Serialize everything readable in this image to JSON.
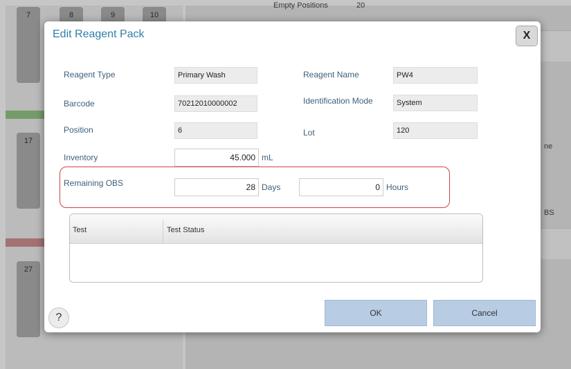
{
  "background": {
    "slot_numbers_top": [
      "7",
      "8",
      "9",
      "10"
    ],
    "slot_numbers_mid": [
      "17"
    ],
    "slot_numbers_bottom": [
      "27"
    ],
    "empty_positions_label": "Empty Positions",
    "empty_positions_value": "20",
    "side_text_1": "ne",
    "side_text_2": "BS"
  },
  "dialog": {
    "title": "Edit Reagent Pack",
    "close_label": "X",
    "fields": {
      "reagent_type_label": "Reagent Type",
      "reagent_type_value": "Primary Wash",
      "reagent_name_label": "Reagent Name",
      "reagent_name_value": "PW4",
      "barcode_label": "Barcode",
      "barcode_value": "70212010000002",
      "identification_mode_label": "Identification Mode",
      "identification_mode_value": "System",
      "position_label": "Position",
      "position_value": "6",
      "lot_label": "Lot",
      "lot_value": "120",
      "inventory_label": "Inventory",
      "inventory_value": "45.000",
      "inventory_unit": "mL",
      "remaining_obs_label": "Remaining OBS",
      "remaining_days_value": "28",
      "days_unit": "Days",
      "remaining_hours_value": "0",
      "hours_unit": "Hours"
    },
    "grid": {
      "columns": [
        "Test",
        "Test Status"
      ],
      "rows": []
    },
    "help_label": "?",
    "ok_label": "OK",
    "cancel_label": "Cancel"
  }
}
